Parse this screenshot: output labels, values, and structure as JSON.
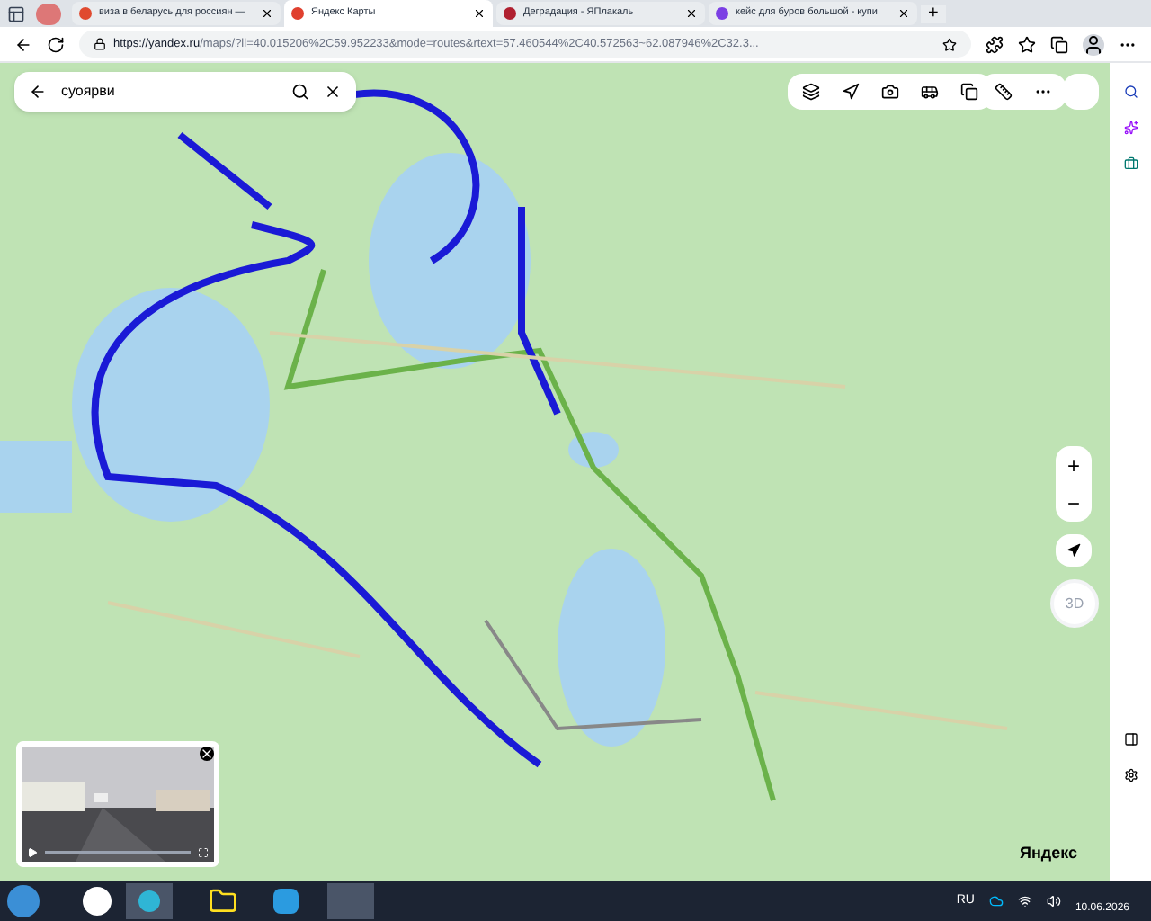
{
  "tabs": [
    {
      "label": "виза в беларусь для россиян —",
      "selected": false,
      "color": "#e04a2f"
    },
    {
      "label": "Яндекс Карты",
      "selected": true,
      "color": "#e0402f"
    },
    {
      "label": "Деградация - ЯПлакаль",
      "selected": false,
      "color": "#b02030"
    },
    {
      "label": "кейс для буров большой - купи",
      "selected": false,
      "color": "#7b3fe4"
    }
  ],
  "new_tab": "+",
  "address_bar": {
    "url_host": "https://yandex.ru",
    "url_rest": "/maps/?ll=40.015206%2C59.952233&mode=routes&rtext=57.460544%2C40.572563~62.087946%2C32.3..."
  },
  "map": {
    "search": {
      "value": "суоярви"
    },
    "logo": "Яндекс",
    "zoom_in": "+",
    "zoom_out": "−",
    "compass": "3D"
  },
  "taskbar": {
    "language": "RU",
    "date": "10.06.2026"
  }
}
